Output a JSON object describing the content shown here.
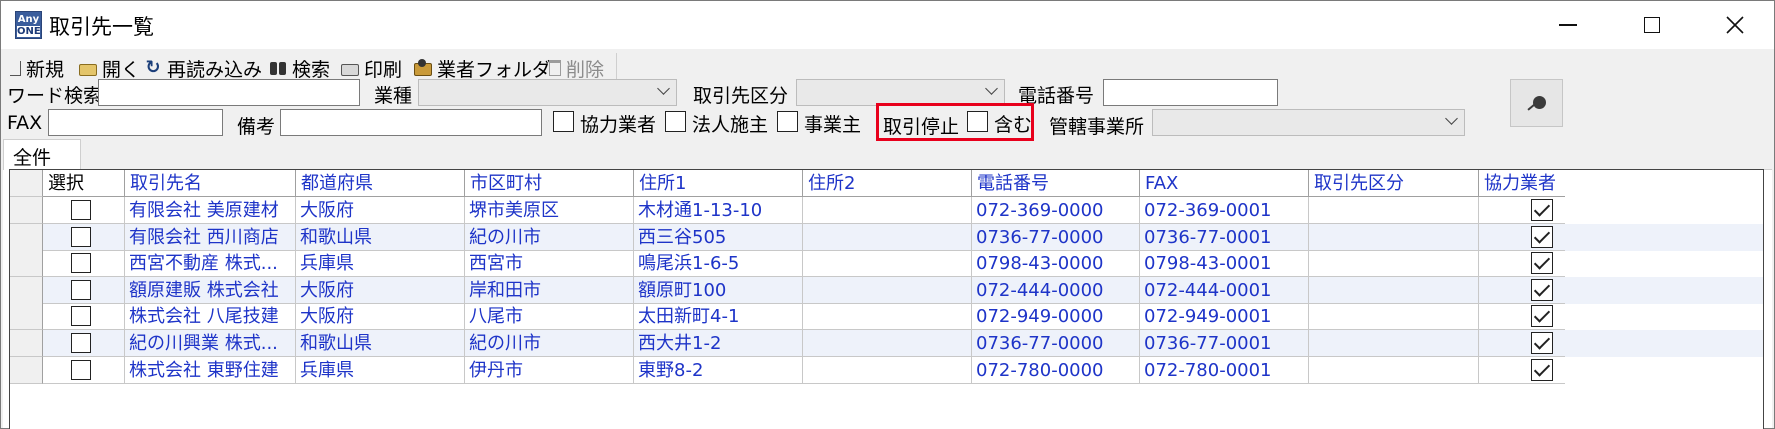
{
  "window": {
    "title": "取引先一覧",
    "app_icon_top": "Any",
    "app_icon_bottom": "ONE"
  },
  "toolbar": {
    "new": "新規",
    "open": "開く",
    "reload": "再読み込み",
    "search": "検索",
    "print": "印刷",
    "vendor_folder": "業者フォルダ",
    "delete": "削除",
    "icons": [
      "new-icon",
      "open-icon",
      "reload-icon",
      "binoculars-icon",
      "printer-icon",
      "folder-icon",
      "trash-icon"
    ]
  },
  "search": {
    "word_label": "ワード検索",
    "word_value": "",
    "industry_label": "業種",
    "industry_value": "",
    "partner_type_label": "取引先区分",
    "partner_type_value": "",
    "phone_label": "電話番号",
    "phone_value": "",
    "fax_label": "FAX",
    "fax_value": "",
    "note_label": "備考",
    "note_value": "",
    "cooperator_label": "協力業者",
    "corporate_label": "法人施主",
    "business_owner_label": "事業主",
    "suspended_label": "取引停止",
    "include_label": "含む",
    "office_label": "管轄事業所",
    "office_value": ""
  },
  "tabs": [
    "全件"
  ],
  "grid": {
    "columns": [
      "選択",
      "取引先名",
      "都道府県",
      "市区町村",
      "住所1",
      "住所2",
      "電話番号",
      "FAX",
      "取引先区分",
      "協力業者"
    ],
    "rows": [
      {
        "name": "有限会社 美原建材",
        "pref": "大阪府",
        "city": "堺市美原区",
        "addr1": "木材通1-13-10",
        "addr2": "",
        "tel": "072-369-0000",
        "fax": "072-369-0001",
        "kbn": "",
        "selected": false,
        "cooperator": true
      },
      {
        "name": "有限会社 西川商店",
        "pref": "和歌山県",
        "city": "紀の川市",
        "addr1": "西三谷505",
        "addr2": "",
        "tel": "0736-77-0000",
        "fax": "0736-77-0001",
        "kbn": "",
        "selected": false,
        "cooperator": true
      },
      {
        "name": "西宮不動産 株式...",
        "pref": "兵庫県",
        "city": "西宮市",
        "addr1": "鳴尾浜1-6-5",
        "addr2": "",
        "tel": "0798-43-0000",
        "fax": "0798-43-0001",
        "kbn": "",
        "selected": false,
        "cooperator": true
      },
      {
        "name": "額原建販 株式会社",
        "pref": "大阪府",
        "city": "岸和田市",
        "addr1": "額原町100",
        "addr2": "",
        "tel": "072-444-0000",
        "fax": "072-444-0001",
        "kbn": "",
        "selected": false,
        "cooperator": true
      },
      {
        "name": "株式会社 八尾技建",
        "pref": "大阪府",
        "city": "八尾市",
        "addr1": "太田新町4-1",
        "addr2": "",
        "tel": "072-949-0000",
        "fax": "072-949-0001",
        "kbn": "",
        "selected": false,
        "cooperator": true
      },
      {
        "name": "紀の川興業 株式...",
        "pref": "和歌山県",
        "city": "紀の川市",
        "addr1": "西大井1-2",
        "addr2": "",
        "tel": "0736-77-0000",
        "fax": "0736-77-0001",
        "kbn": "",
        "selected": false,
        "cooperator": true
      },
      {
        "name": "株式会社 東野住建",
        "pref": "兵庫県",
        "city": "伊丹市",
        "addr1": "東野8-2",
        "addr2": "",
        "tel": "072-780-0000",
        "fax": "072-780-0001",
        "kbn": "",
        "selected": false,
        "cooperator": true
      }
    ]
  },
  "colors": {
    "link_text": "#1e34c8",
    "highlight_border": "#e8001c",
    "alt_row": "#eef2fa"
  }
}
